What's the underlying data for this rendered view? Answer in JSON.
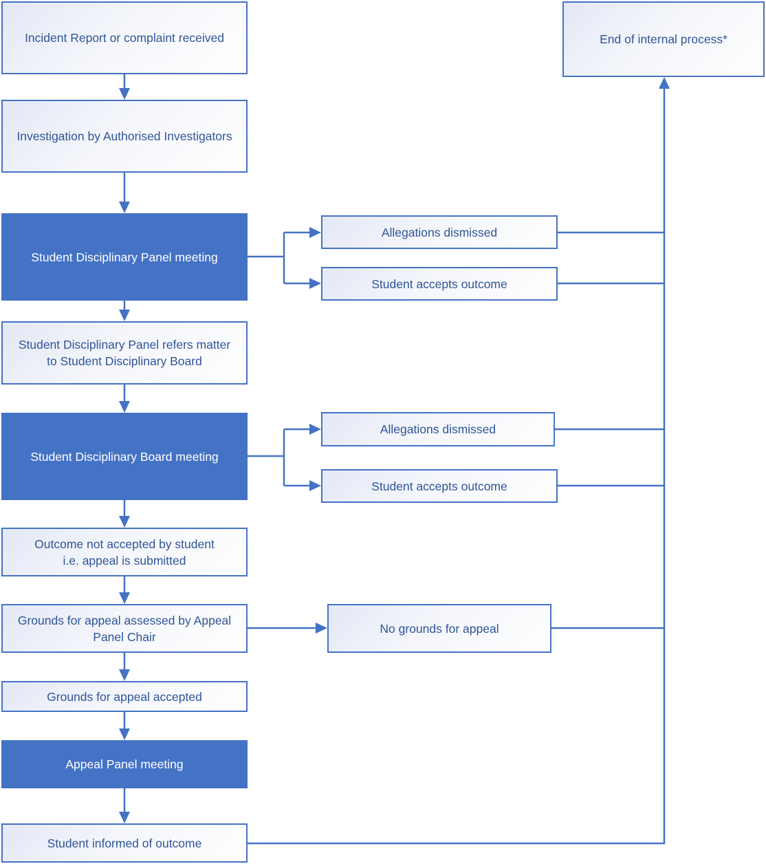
{
  "diagram": {
    "type": "flowchart",
    "colors": {
      "accent": "#4472c4",
      "text": "#2f5597",
      "filled_text": "#ffffff",
      "gradient_start": "#e4e8f5",
      "gradient_end": "#ffffff"
    },
    "nodes": [
      {
        "id": "incident",
        "label": "Incident Report or complaint received",
        "style": "outline"
      },
      {
        "id": "investigation",
        "label": "Investigation by Authorised Investigators",
        "style": "outline"
      },
      {
        "id": "panel_meeting",
        "label": "Student Disciplinary Panel meeting",
        "style": "filled"
      },
      {
        "id": "panel_refers",
        "label": "Student Disciplinary Panel refers matter\nto Student Disciplinary Board",
        "style": "outline"
      },
      {
        "id": "board_meeting",
        "label": "Student Disciplinary Board meeting",
        "style": "filled"
      },
      {
        "id": "not_accepted",
        "label": "Outcome not accepted by student\ni.e. appeal is submitted",
        "style": "outline"
      },
      {
        "id": "grounds_assessed",
        "label": "Grounds for appeal assessed by Appeal\nPanel Chair",
        "style": "outline"
      },
      {
        "id": "grounds_accepted",
        "label": "Grounds for appeal accepted",
        "style": "outline"
      },
      {
        "id": "appeal_meeting",
        "label": "Appeal Panel meeting",
        "style": "filled"
      },
      {
        "id": "informed",
        "label": "Student informed of outcome",
        "style": "outline"
      },
      {
        "id": "end",
        "label": "End of internal process*",
        "style": "outline"
      },
      {
        "id": "panel_dismissed",
        "label": "Allegations dismissed",
        "style": "outline"
      },
      {
        "id": "panel_accepts",
        "label": "Student accepts outcome",
        "style": "outline"
      },
      {
        "id": "board_dismissed",
        "label": "Allegations dismissed",
        "style": "outline"
      },
      {
        "id": "board_accepts",
        "label": "Student accepts outcome",
        "style": "outline"
      },
      {
        "id": "no_grounds",
        "label": "No grounds for appeal",
        "style": "outline"
      }
    ],
    "edges": [
      {
        "from": "incident",
        "to": "investigation"
      },
      {
        "from": "investigation",
        "to": "panel_meeting"
      },
      {
        "from": "panel_meeting",
        "to": "panel_refers"
      },
      {
        "from": "panel_refers",
        "to": "board_meeting"
      },
      {
        "from": "board_meeting",
        "to": "not_accepted"
      },
      {
        "from": "not_accepted",
        "to": "grounds_assessed"
      },
      {
        "from": "grounds_assessed",
        "to": "grounds_accepted"
      },
      {
        "from": "grounds_accepted",
        "to": "appeal_meeting"
      },
      {
        "from": "appeal_meeting",
        "to": "informed"
      },
      {
        "from": "panel_meeting",
        "to": "panel_dismissed"
      },
      {
        "from": "panel_meeting",
        "to": "panel_accepts"
      },
      {
        "from": "board_meeting",
        "to": "board_dismissed"
      },
      {
        "from": "board_meeting",
        "to": "board_accepts"
      },
      {
        "from": "grounds_assessed",
        "to": "no_grounds"
      },
      {
        "from": "panel_dismissed",
        "to": "end"
      },
      {
        "from": "panel_accepts",
        "to": "end"
      },
      {
        "from": "board_dismissed",
        "to": "end"
      },
      {
        "from": "board_accepts",
        "to": "end"
      },
      {
        "from": "no_grounds",
        "to": "end"
      },
      {
        "from": "informed",
        "to": "end"
      }
    ]
  }
}
